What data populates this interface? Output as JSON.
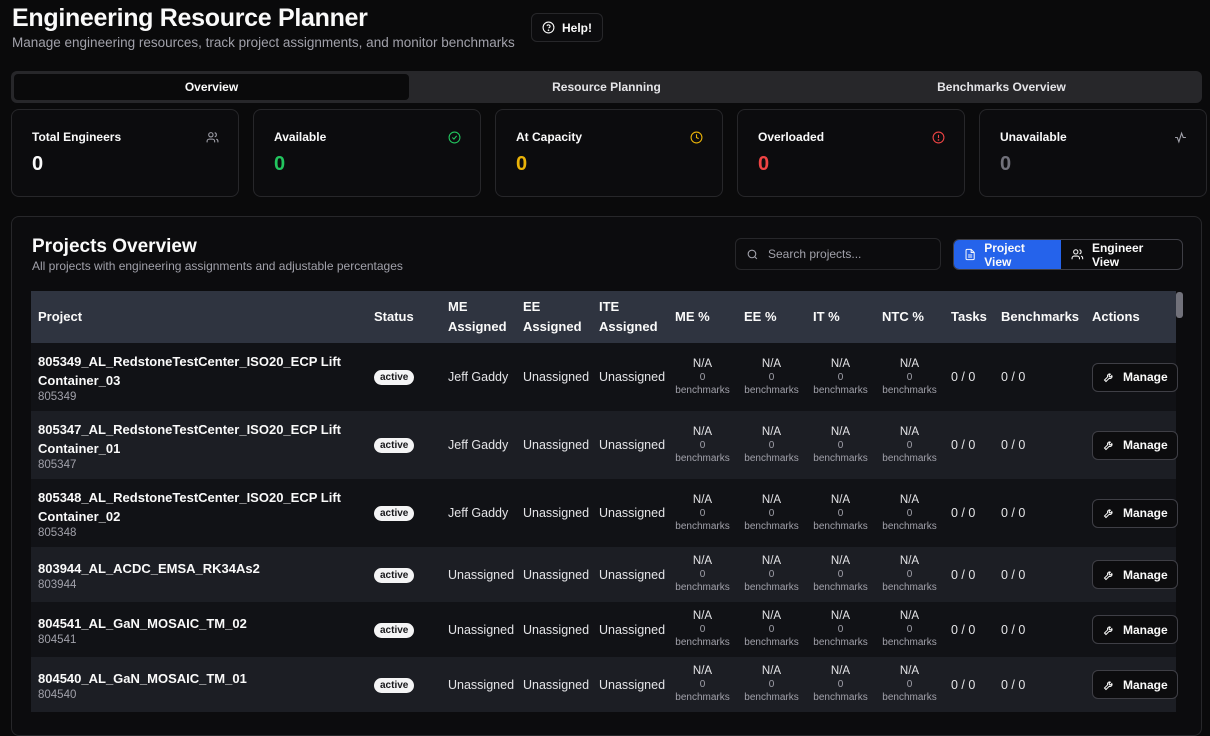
{
  "header": {
    "title": "Engineering Resource Planner",
    "subtitle": "Manage engineering resources, track project assignments, and monitor benchmarks",
    "help_label": "Help!"
  },
  "tabs": [
    {
      "label": "Overview",
      "active": true
    },
    {
      "label": "Resource Planning",
      "active": false
    },
    {
      "label": "Benchmarks Overview",
      "active": false
    }
  ],
  "stats": [
    {
      "label": "Total Engineers",
      "value": "0",
      "color": "#fafafa",
      "icon": "users-icon"
    },
    {
      "label": "Available",
      "value": "0",
      "color": "#22c55e",
      "icon": "check-circle-icon"
    },
    {
      "label": "At Capacity",
      "value": "0",
      "color": "#eab308",
      "icon": "clock-icon"
    },
    {
      "label": "Overloaded",
      "value": "0",
      "color": "#ef4444",
      "icon": "alert-circle-icon"
    },
    {
      "label": "Unavailable",
      "value": "0",
      "color": "#71717a",
      "icon": "activity-icon"
    }
  ],
  "projects_panel": {
    "title": "Projects Overview",
    "subtitle": "All projects with engineering assignments and adjustable percentages",
    "search_placeholder": "Search projects...",
    "view_project": "Project View",
    "view_engineer": "Engineer View"
  },
  "table": {
    "columns": [
      {
        "line1": "Project",
        "line2": ""
      },
      {
        "line1": "Status",
        "line2": ""
      },
      {
        "line1": "ME",
        "line2": "Assigned"
      },
      {
        "line1": "EE",
        "line2": "Assigned"
      },
      {
        "line1": "ITE",
        "line2": "Assigned"
      },
      {
        "line1": "ME %",
        "line2": ""
      },
      {
        "line1": "EE %",
        "line2": ""
      },
      {
        "line1": "IT %",
        "line2": ""
      },
      {
        "line1": "NTC %",
        "line2": ""
      },
      {
        "line1": "Tasks",
        "line2": ""
      },
      {
        "line1": "Benchmarks",
        "line2": ""
      },
      {
        "line1": "Actions",
        "line2": ""
      }
    ],
    "pct_na": "N/A",
    "pct_count": "0",
    "pct_unit": "benchmarks",
    "manage_label": "Manage",
    "rows": [
      {
        "name": "805349_AL_RedstoneTestCenter_ISO20_ECP Lift Container_03",
        "id": "805349",
        "status": "active",
        "me": "Jeff Gaddy",
        "ee": "Unassigned",
        "ite": "Unassigned",
        "tasks": "0 / 0",
        "benchmarks": "0 / 0"
      },
      {
        "name": "805347_AL_RedstoneTestCenter_ISO20_ECP Lift Container_01",
        "id": "805347",
        "status": "active",
        "me": "Jeff Gaddy",
        "ee": "Unassigned",
        "ite": "Unassigned",
        "tasks": "0 / 0",
        "benchmarks": "0 / 0"
      },
      {
        "name": "805348_AL_RedstoneTestCenter_ISO20_ECP Lift Container_02",
        "id": "805348",
        "status": "active",
        "me": "Jeff Gaddy",
        "ee": "Unassigned",
        "ite": "Unassigned",
        "tasks": "0 / 0",
        "benchmarks": "0 / 0"
      },
      {
        "name": "803944_AL_ACDC_EMSA_RK34As2",
        "id": "803944",
        "status": "active",
        "me": "Unassigned",
        "ee": "Unassigned",
        "ite": "Unassigned",
        "tasks": "0 / 0",
        "benchmarks": "0 / 0"
      },
      {
        "name": "804541_AL_GaN_MOSAIC_TM_02",
        "id": "804541",
        "status": "active",
        "me": "Unassigned",
        "ee": "Unassigned",
        "ite": "Unassigned",
        "tasks": "0 / 0",
        "benchmarks": "0 / 0"
      },
      {
        "name": "804540_AL_GaN_MOSAIC_TM_01",
        "id": "804540",
        "status": "active",
        "me": "Unassigned",
        "ee": "Unassigned",
        "ite": "Unassigned",
        "tasks": "0 / 0",
        "benchmarks": "0 / 0"
      }
    ]
  }
}
